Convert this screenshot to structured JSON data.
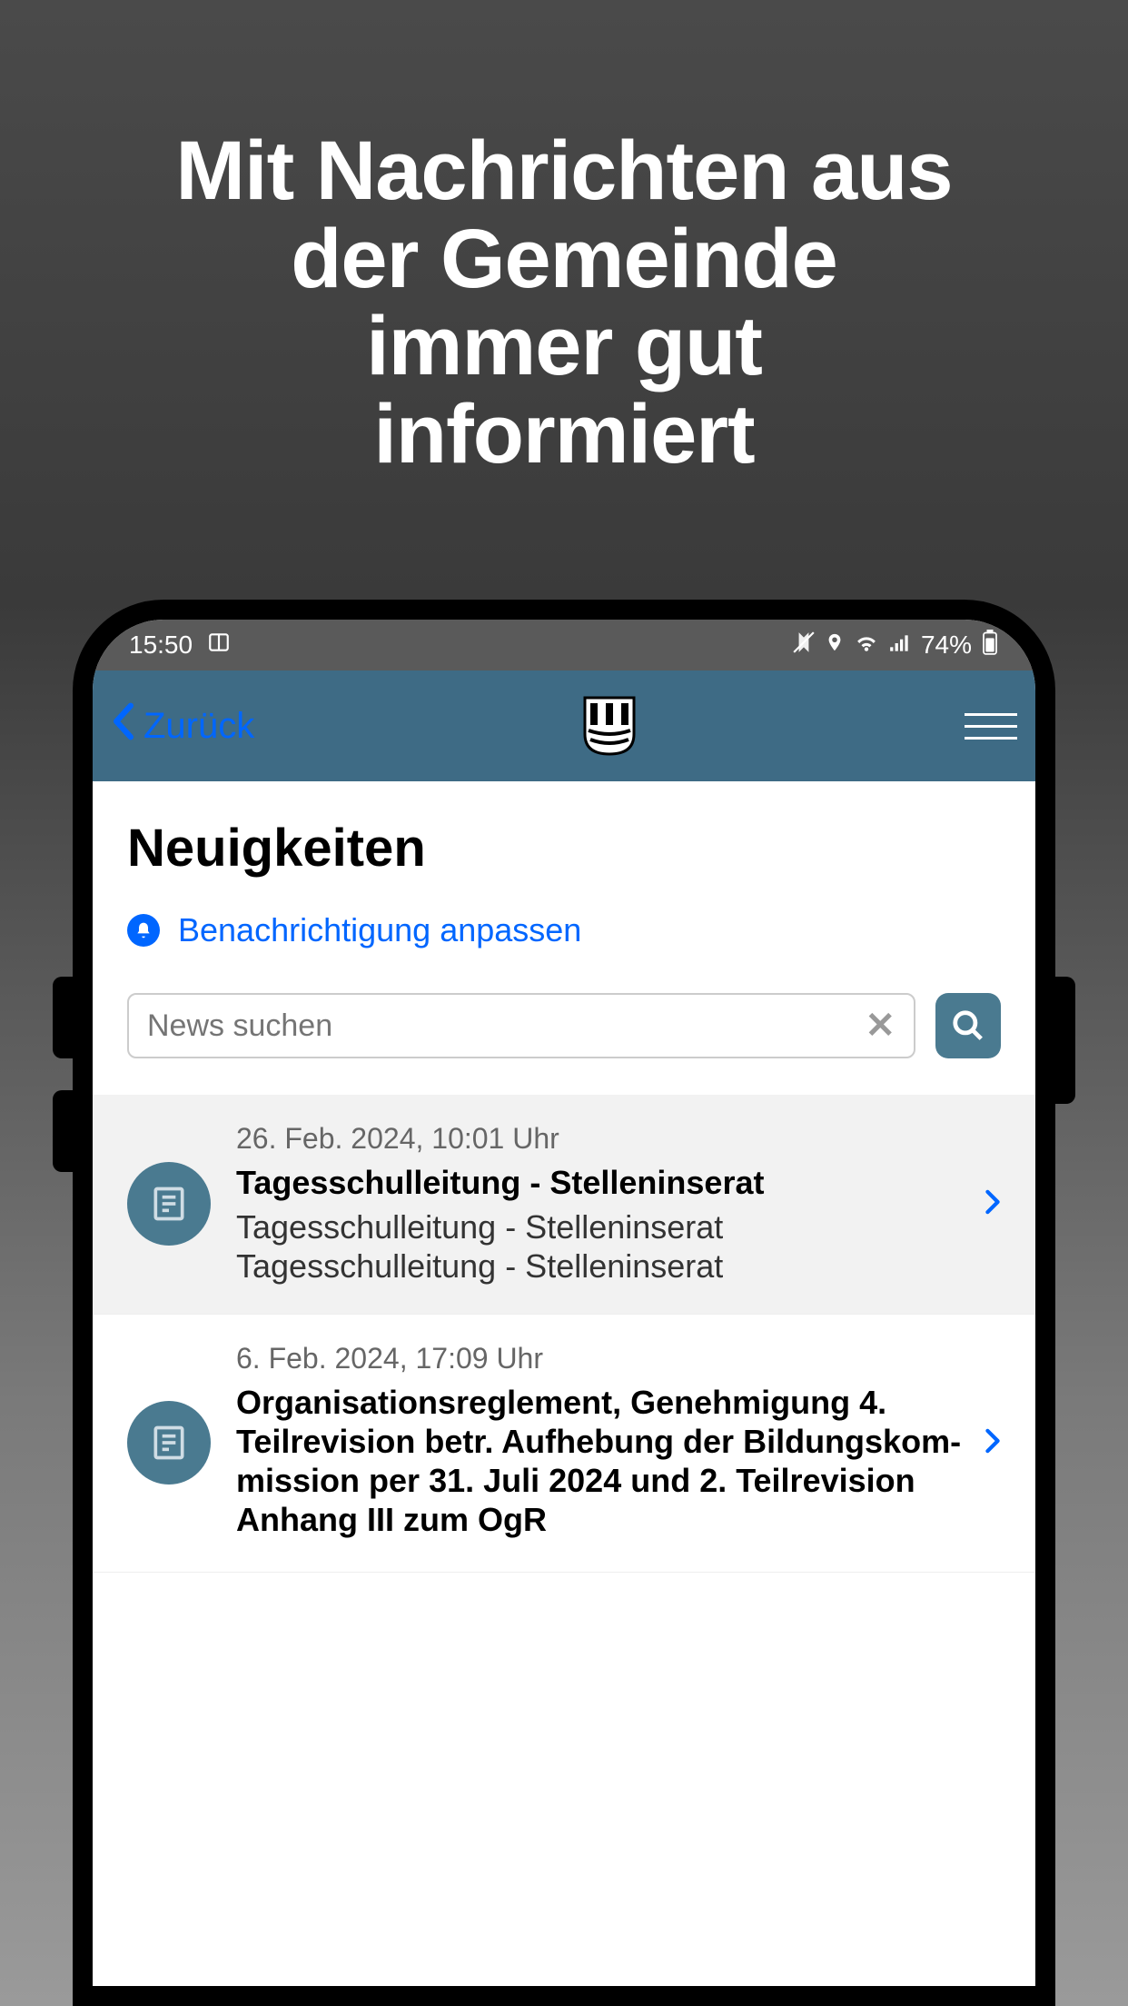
{
  "promo": {
    "line1": "Mit Nachrichten aus",
    "line2": "der Gemeinde",
    "line3": "immer gut",
    "line4": "informiert"
  },
  "status_bar": {
    "time": "15:50",
    "battery": "74%"
  },
  "header": {
    "back_label": "Zurück"
  },
  "page": {
    "title": "Neuigkeiten",
    "notification_link": "Benachrichtigung anpassen"
  },
  "search": {
    "placeholder": "News suchen"
  },
  "news": [
    {
      "date": "26. Feb. 2024, 10:01 Uhr",
      "title": "Tagesschulleitung - Stellenin­serat",
      "excerpt": "Tagesschulleitung - Stellenin­serat Tagesschulleitung - Stel­leninserat"
    },
    {
      "date": "6. Feb. 2024, 17:09 Uhr",
      "title": "Organisationsreglement, Ge­nehmigung 4. Teilrevision betr. Aufhebung der Bildungskom­mission per 31. Juli 2024 und 2. Teilrevision Anhang III zum OgR",
      "excerpt": ""
    }
  ]
}
